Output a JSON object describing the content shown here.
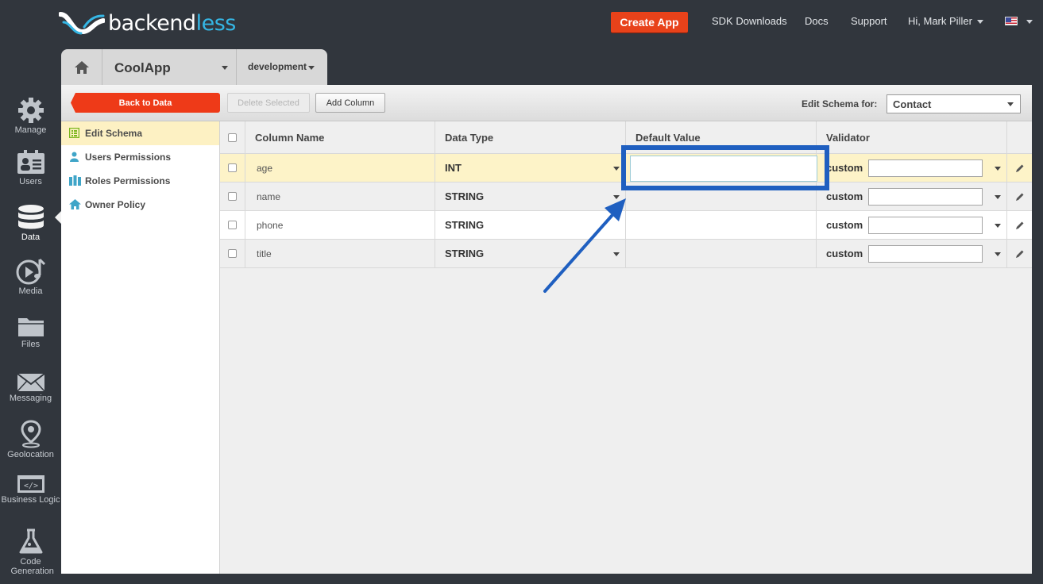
{
  "header": {
    "logo_back": "back",
    "logo_end": "end",
    "logo_less": "less",
    "create_app": "Create App",
    "links": [
      "SDK Downloads",
      "Docs",
      "Support"
    ],
    "user_greeting": "Hi, Mark Piller",
    "locale": "en-US"
  },
  "rail": [
    {
      "label": "Manage",
      "icon": "gear-icon"
    },
    {
      "label": "Users",
      "icon": "users-icon"
    },
    {
      "label": "Data",
      "icon": "database-icon"
    },
    {
      "label": "Media",
      "icon": "media-icon"
    },
    {
      "label": "Files",
      "icon": "folder-icon"
    },
    {
      "label": "Messaging",
      "icon": "envelope-icon"
    },
    {
      "label": "Geolocation",
      "icon": "pin-icon"
    },
    {
      "label": "Business Logic",
      "icon": "code-icon"
    },
    {
      "label": "Code Generation",
      "icon": "flask-icon"
    }
  ],
  "app": {
    "name": "CoolApp",
    "environment": "development"
  },
  "toolbar": {
    "back": "Back to Data",
    "delete": "Delete Selected",
    "add": "Add Column",
    "schema_label": "Edit Schema for:",
    "schema_value": "Contact"
  },
  "submenu": [
    {
      "label": "Edit Schema",
      "icon": "schema-icon"
    },
    {
      "label": "Users Permissions",
      "icon": "user-icon"
    },
    {
      "label": "Roles Permissions",
      "icon": "roles-icon"
    },
    {
      "label": "Owner Policy",
      "icon": "house-icon"
    }
  ],
  "table": {
    "headers": [
      "Column Name",
      "Data Type",
      "Default Value",
      "Validator"
    ],
    "rows": [
      {
        "name": "age",
        "type": "INT",
        "validator": "custom"
      },
      {
        "name": "name",
        "type": "STRING",
        "validator": "custom"
      },
      {
        "name": "phone",
        "type": "STRING",
        "validator": "custom"
      },
      {
        "name": "title",
        "type": "STRING",
        "validator": "custom"
      }
    ]
  },
  "colors": {
    "accent": "#e8421a",
    "brand_blue": "#35b6e4",
    "callout": "#1f5fc0"
  }
}
